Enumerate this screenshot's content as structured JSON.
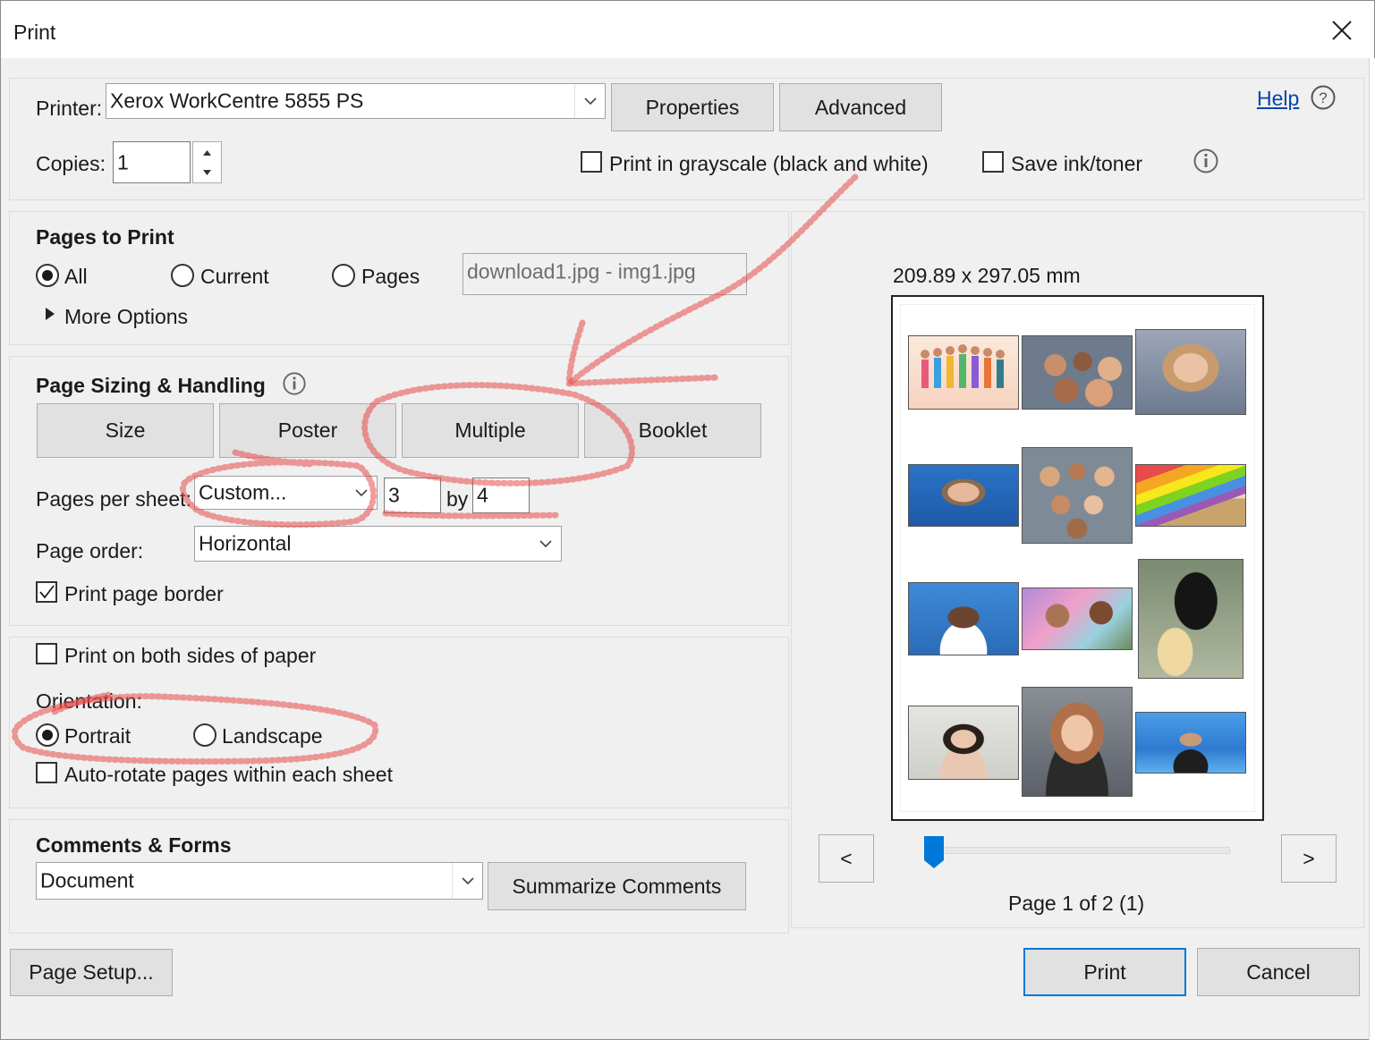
{
  "window": {
    "title": "Print"
  },
  "printer": {
    "label": "Printer:",
    "selected": "Xerox WorkCentre 5855 PS",
    "properties_label": "Properties",
    "advanced_label": "Advanced",
    "help_label": "Help"
  },
  "copies": {
    "label": "Copies:",
    "value": "1"
  },
  "options": {
    "grayscale_label": "Print in grayscale (black and white)",
    "grayscale_checked": false,
    "save_ink_label": "Save ink/toner",
    "save_ink_checked": false
  },
  "pages_to_print": {
    "heading": "Pages to Print",
    "all_label": "All",
    "current_label": "Current",
    "pages_label": "Pages",
    "selected": "All",
    "pages_field": "download1.jpg - img1.jpg",
    "more_options_label": "More Options"
  },
  "sizing": {
    "heading": "Page Sizing & Handling",
    "tabs": [
      "Size",
      "Poster",
      "Multiple",
      "Booklet"
    ],
    "active_tab": "Multiple",
    "pages_per_sheet_label": "Pages per sheet:",
    "pages_per_sheet_value": "Custom...",
    "cols": "3",
    "by_label": "by",
    "rows": "4",
    "page_order_label": "Page order:",
    "page_order_value": "Horizontal",
    "print_border_label": "Print page border",
    "print_border_checked": true
  },
  "duplex": {
    "both_sides_label": "Print on both sides of paper",
    "both_sides_checked": false,
    "orientation_label": "Orientation:",
    "portrait_label": "Portrait",
    "landscape_label": "Landscape",
    "orientation_selected": "Portrait",
    "auto_rotate_label": "Auto-rotate pages within each sheet",
    "auto_rotate_checked": false
  },
  "comments": {
    "heading": "Comments & Forms",
    "value": "Document",
    "summarize_label": "Summarize Comments"
  },
  "preview": {
    "dimensions": "209.89 x 297.05 mm",
    "prev_label": "<",
    "next_label": ">",
    "page_status": "Page 1 of 2 (1)",
    "slider_position": 0.0
  },
  "footer": {
    "page_setup_label": "Page Setup...",
    "print_label": "Print",
    "cancel_label": "Cancel"
  },
  "colors": {
    "annotation_red": "#e84a4a",
    "accent_blue": "#0078d7",
    "link_blue": "#0645ad"
  }
}
